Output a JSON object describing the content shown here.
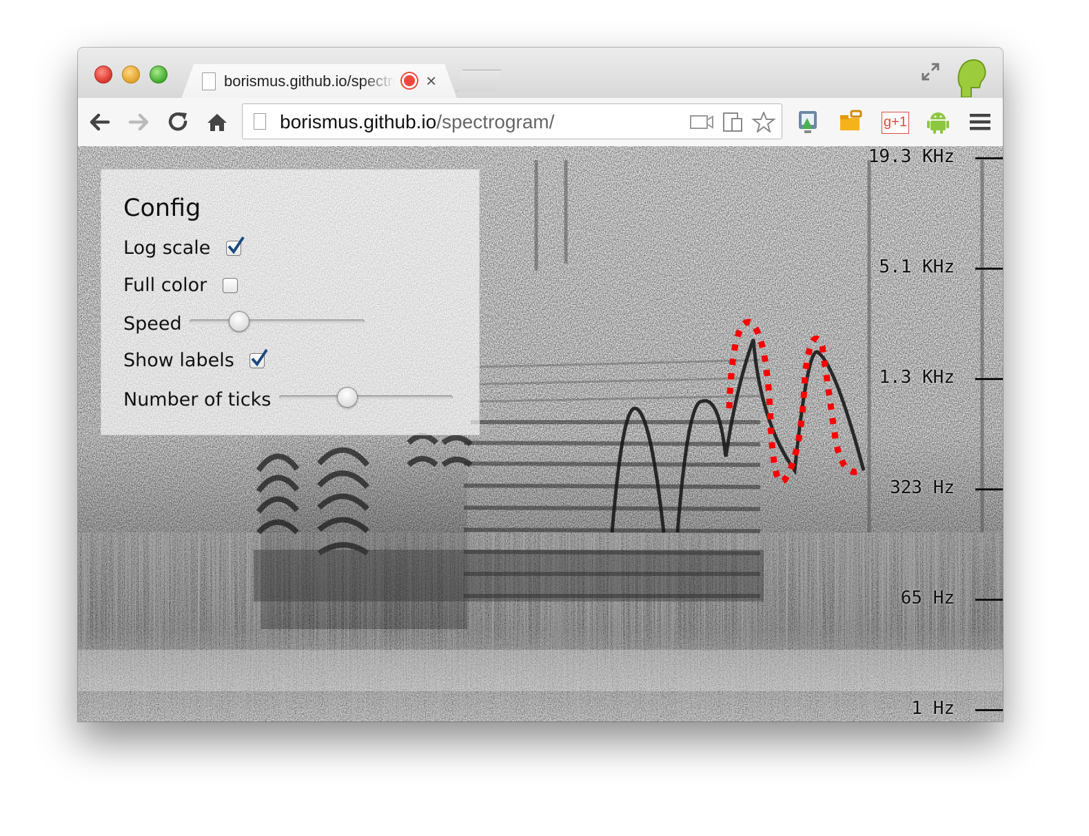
{
  "browser": {
    "tab_title": "borismus.github.io/spectrogram/",
    "url_host": "borismus.github.io",
    "url_path": "/spectrogram/",
    "icons": [
      "back-icon",
      "forward-icon",
      "reload-icon",
      "home-icon",
      "page-icon",
      "camera-icon",
      "device-icon",
      "star-icon",
      "extension-icon",
      "folder-key-icon",
      "google-plus-one-icon",
      "android-icon",
      "menu-icon",
      "fullscreen-icon",
      "avatar-icon",
      "record-icon",
      "close-icon"
    ],
    "ext_gplus_label": "g+1",
    "colors": {
      "record": "#f0483e",
      "android": "#8dc63f",
      "folder": "#f5b21b",
      "gplus": "#dd4b39",
      "close_light": "#fc5f56",
      "minimize_light": "#fdbc2e",
      "maximize_light": "#33c748"
    }
  },
  "config": {
    "title": "Config",
    "log_scale": {
      "label": "Log scale",
      "checked": true
    },
    "full_color": {
      "label": "Full color",
      "checked": false
    },
    "speed": {
      "label": "Speed",
      "value": 0.28
    },
    "show_labels": {
      "label": "Show labels",
      "checked": true
    },
    "number_of_ticks": {
      "label": "Number of ticks",
      "value": 0.39
    }
  },
  "axis": {
    "ticks": [
      {
        "value": "19.3",
        "unit": "KHz"
      },
      {
        "value": "5.1",
        "unit": "KHz"
      },
      {
        "value": "1.3",
        "unit": "KHz"
      },
      {
        "value": "323",
        "unit": "Hz"
      },
      {
        "value": "65",
        "unit": "Hz"
      },
      {
        "value": "1",
        "unit": "Hz"
      }
    ]
  },
  "colors": {
    "overlay_curve": "#ff0000",
    "trace": "#1a1a1a"
  }
}
